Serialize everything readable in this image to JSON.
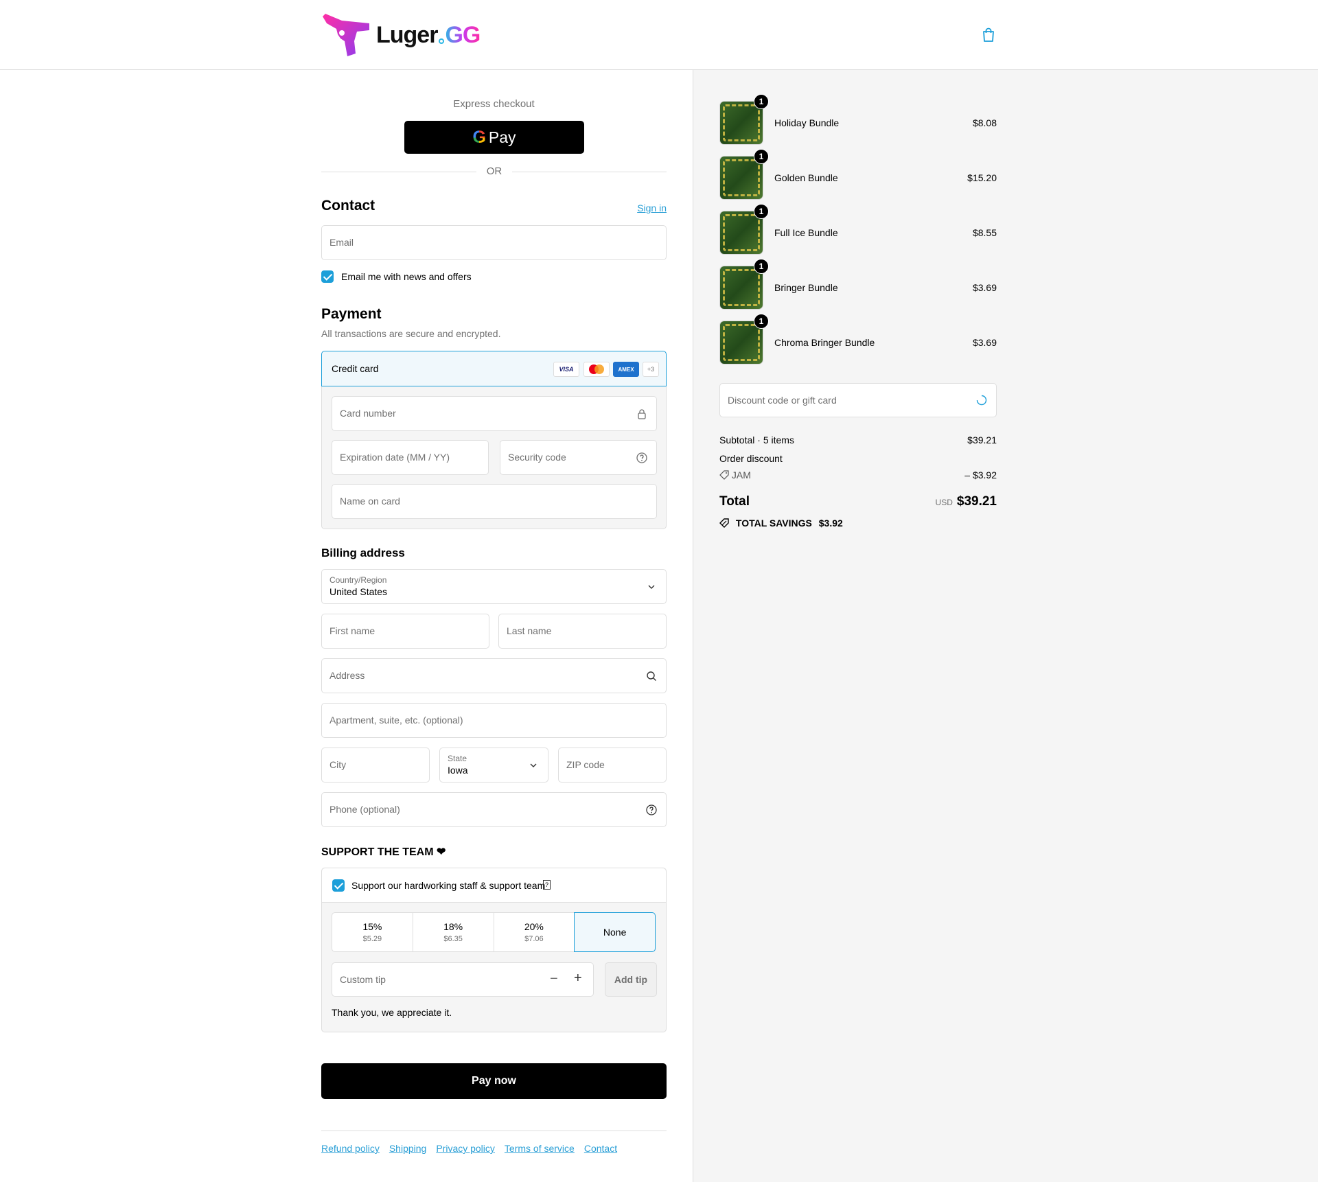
{
  "brand": {
    "name": "Luger",
    "suffix": "GG"
  },
  "express": {
    "label": "Express checkout",
    "gpay_g": "G",
    "gpay_label": "Pay",
    "or": "OR"
  },
  "contact": {
    "title": "Contact",
    "sign_in": "Sign in",
    "email_placeholder": "Email",
    "newsletter": "Email me with news and offers"
  },
  "payment": {
    "title": "Payment",
    "subtitle": "All transactions are secure and encrypted.",
    "method": "Credit card",
    "brands": [
      "VISA",
      "AMEX",
      "+3"
    ],
    "card_number": "Card number",
    "expiration": "Expiration date (MM / YY)",
    "security": "Security code",
    "name_on_card": "Name on card"
  },
  "billing": {
    "title": "Billing address",
    "country_label": "Country/Region",
    "country_value": "United States",
    "first_name": "First name",
    "last_name": "Last name",
    "address": "Address",
    "apartment": "Apartment, suite, etc. (optional)",
    "city": "City",
    "state_label": "State",
    "state_value": "Iowa",
    "zip": "ZIP code",
    "phone": "Phone (optional)"
  },
  "tip": {
    "title": "SUPPORT THE TEAM ❤",
    "checkbox_label": "Support our hardworking staff & support team",
    "options": [
      {
        "pct": "15%",
        "amt": "$5.29"
      },
      {
        "pct": "18%",
        "amt": "$6.35"
      },
      {
        "pct": "20%",
        "amt": "$7.06"
      },
      {
        "pct": "None",
        "amt": ""
      }
    ],
    "custom_placeholder": "Custom tip",
    "minus": "−",
    "plus": "+",
    "add": "Add tip",
    "thanks": "Thank you, we appreciate it."
  },
  "pay_now": "Pay now",
  "footer_links": [
    "Refund policy",
    "Shipping",
    "Privacy policy",
    "Terms of service",
    "Contact"
  ],
  "order": {
    "items": [
      {
        "name": "Holiday Bundle",
        "qty": "1",
        "price": "$8.08"
      },
      {
        "name": "Golden Bundle",
        "qty": "1",
        "price": "$15.20"
      },
      {
        "name": "Full Ice Bundle",
        "qty": "1",
        "price": "$8.55"
      },
      {
        "name": "Bringer Bundle",
        "qty": "1",
        "price": "$3.69"
      },
      {
        "name": "Chroma Bringer Bundle",
        "qty": "1",
        "price": "$3.69"
      }
    ],
    "discount_placeholder": "Discount code or gift card",
    "subtotal_label": "Subtotal · 5 items",
    "subtotal_value": "$39.21",
    "order_discount_label": "Order discount",
    "discount_code": "JAM",
    "discount_value": "– $3.92",
    "total_label": "Total",
    "currency": "USD",
    "total_value": "$39.21",
    "savings_label": "TOTAL SAVINGS",
    "savings_value": "$3.92"
  },
  "colors": {
    "accent": "#1d9fd9",
    "link": "#2a9fd6",
    "button": "#000000",
    "panel": "#f5f5f5"
  }
}
